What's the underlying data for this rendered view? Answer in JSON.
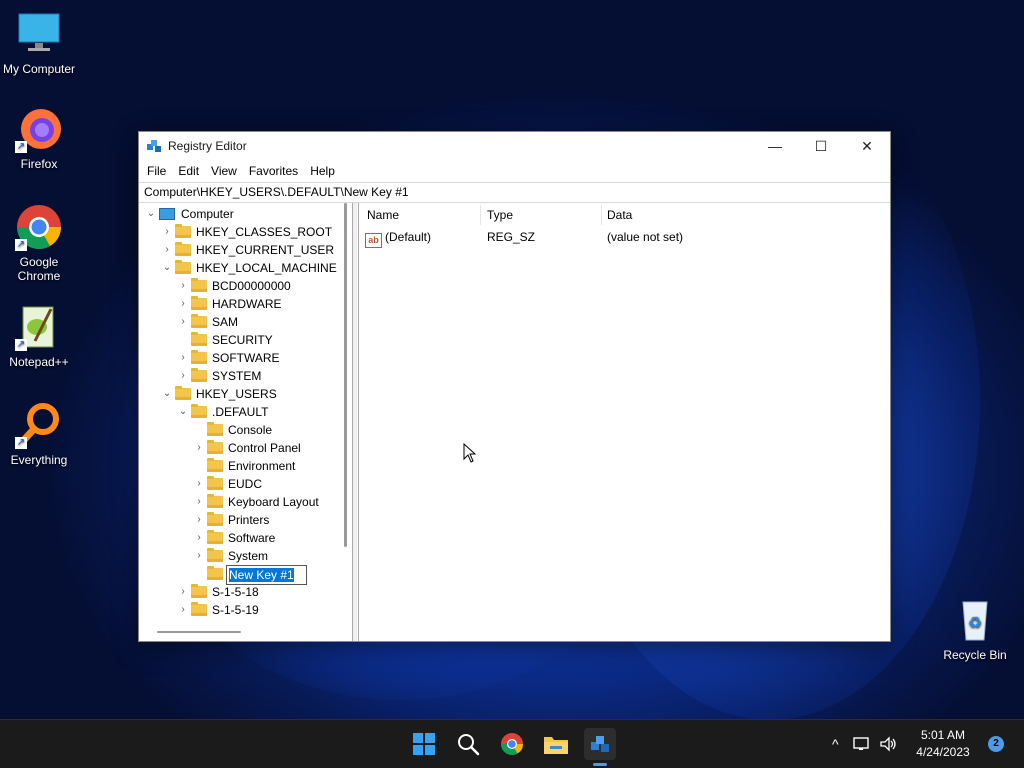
{
  "desktop": {
    "icons": [
      {
        "label": "My Computer",
        "icon": "monitor-icon"
      },
      {
        "label": "Firefox",
        "icon": "firefox-icon"
      },
      {
        "label": "Google Chrome",
        "icon": "chrome-icon"
      },
      {
        "label": "Notepad++",
        "icon": "notepadpp-icon"
      },
      {
        "label": "Everything",
        "icon": "search-magnifier-icon"
      },
      {
        "label": "Recycle Bin",
        "icon": "recycle-bin-icon"
      }
    ]
  },
  "window": {
    "title": "Registry Editor",
    "controls": {
      "minimize": "—",
      "maximize": "☐",
      "close": "✕"
    },
    "menu": [
      "File",
      "Edit",
      "View",
      "Favorites",
      "Help"
    ],
    "address": "Computer\\HKEY_USERS\\.DEFAULT\\New Key #1"
  },
  "tree": [
    {
      "label": "Computer",
      "toggle": "⌄"
    },
    {
      "label": "HKEY_CLASSES_ROOT",
      "toggle": "›"
    },
    {
      "label": "HKEY_CURRENT_USER",
      "toggle": "›"
    },
    {
      "label": "HKEY_LOCAL_MACHINE",
      "toggle": "⌄"
    },
    {
      "label": "BCD00000000",
      "toggle": "›"
    },
    {
      "label": "HARDWARE",
      "toggle": "›"
    },
    {
      "label": "SAM",
      "toggle": "›"
    },
    {
      "label": "SECURITY",
      "toggle": ""
    },
    {
      "label": "SOFTWARE",
      "toggle": "›"
    },
    {
      "label": "SYSTEM",
      "toggle": "›"
    },
    {
      "label": "HKEY_USERS",
      "toggle": "⌄"
    },
    {
      "label": ".DEFAULT",
      "toggle": "⌄"
    },
    {
      "label": "Console",
      "toggle": ""
    },
    {
      "label": "Control Panel",
      "toggle": "›"
    },
    {
      "label": "Environment",
      "toggle": ""
    },
    {
      "label": "EUDC",
      "toggle": "›"
    },
    {
      "label": "Keyboard Layout",
      "toggle": "›"
    },
    {
      "label": "Printers",
      "toggle": "›"
    },
    {
      "label": "Software",
      "toggle": "›"
    },
    {
      "label": "System",
      "toggle": "›"
    },
    {
      "label": "New Key #1",
      "toggle": ""
    },
    {
      "label": "S-1-5-18",
      "toggle": "›"
    },
    {
      "label": "S-1-5-19",
      "toggle": "›"
    }
  ],
  "list": {
    "columns": [
      "Name",
      "Type",
      "Data"
    ],
    "rows": [
      {
        "name": "(Default)",
        "type": "REG_SZ",
        "data": "(value not set)",
        "icon_text": "ab"
      }
    ]
  },
  "taskbar": {
    "apps": [
      "start-icon",
      "search-icon",
      "chrome-icon",
      "file-explorer-icon",
      "registry-editor-icon"
    ],
    "tray": {
      "chevron": "^",
      "time": "5:01 AM",
      "date": "4/24/2023",
      "notifications": "2"
    }
  },
  "colors": {
    "accent": "#0078d7",
    "folder": "#f3c64a",
    "taskbar": "#1b1b1b"
  }
}
